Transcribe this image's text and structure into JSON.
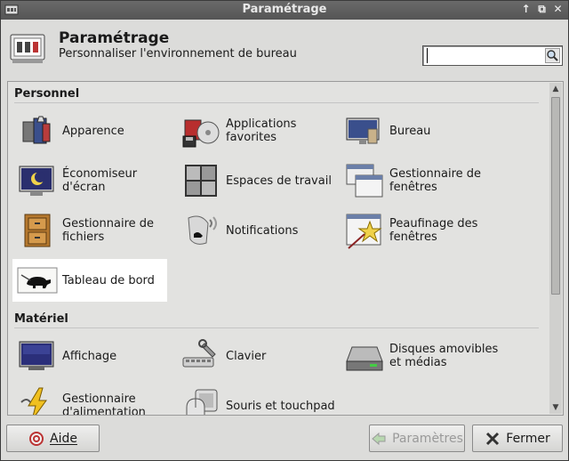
{
  "window": {
    "title": "Paramétrage"
  },
  "header": {
    "title": "Paramétrage",
    "subtitle": "Personnaliser l'environnement de bureau"
  },
  "search": {
    "value": "",
    "placeholder": ""
  },
  "sections": [
    {
      "title": "Personnel",
      "items": [
        {
          "label_line1": "Apparence",
          "label_line2": "",
          "icon": "appearance-icon"
        },
        {
          "label_line1": "Applications",
          "label_line2": "favorites",
          "icon": "preferred-applications-icon"
        },
        {
          "label_line1": "Bureau",
          "label_line2": "",
          "icon": "desktop-icon"
        },
        {
          "label_line1": "Économiseur",
          "label_line2": "d'écran",
          "icon": "screensaver-icon"
        },
        {
          "label_line1": "Espaces de travail",
          "label_line2": "",
          "icon": "workspaces-icon"
        },
        {
          "label_line1": "Gestionnaire de",
          "label_line2": "fenêtres",
          "icon": "window-manager-icon"
        },
        {
          "label_line1": "Gestionnaire de",
          "label_line2": "fichiers",
          "icon": "file-manager-icon"
        },
        {
          "label_line1": "Notifications",
          "label_line2": "",
          "icon": "notifications-icon"
        },
        {
          "label_line1": "Peaufinage des",
          "label_line2": "fenêtres",
          "icon": "window-tweaks-icon"
        },
        {
          "label_line1": "Tableau de bord",
          "label_line2": "",
          "icon": "panel-icon"
        }
      ]
    },
    {
      "title": "Matériel",
      "items": [
        {
          "label_line1": "Affichage",
          "label_line2": "",
          "icon": "display-icon"
        },
        {
          "label_line1": "Clavier",
          "label_line2": "",
          "icon": "keyboard-icon"
        },
        {
          "label_line1": "Disques amovibles",
          "label_line2": "et médias",
          "icon": "removable-drives-icon"
        },
        {
          "label_line1": "Gestionnaire",
          "label_line2": "d'alimentation",
          "icon": "power-manager-icon"
        },
        {
          "label_line1": "Souris et touchpad",
          "label_line2": "",
          "icon": "mouse-icon"
        }
      ]
    }
  ],
  "selected_item": "Tableau de bord",
  "buttons": {
    "help": "Aide",
    "settings": "Paramètres",
    "close": "Fermer"
  }
}
